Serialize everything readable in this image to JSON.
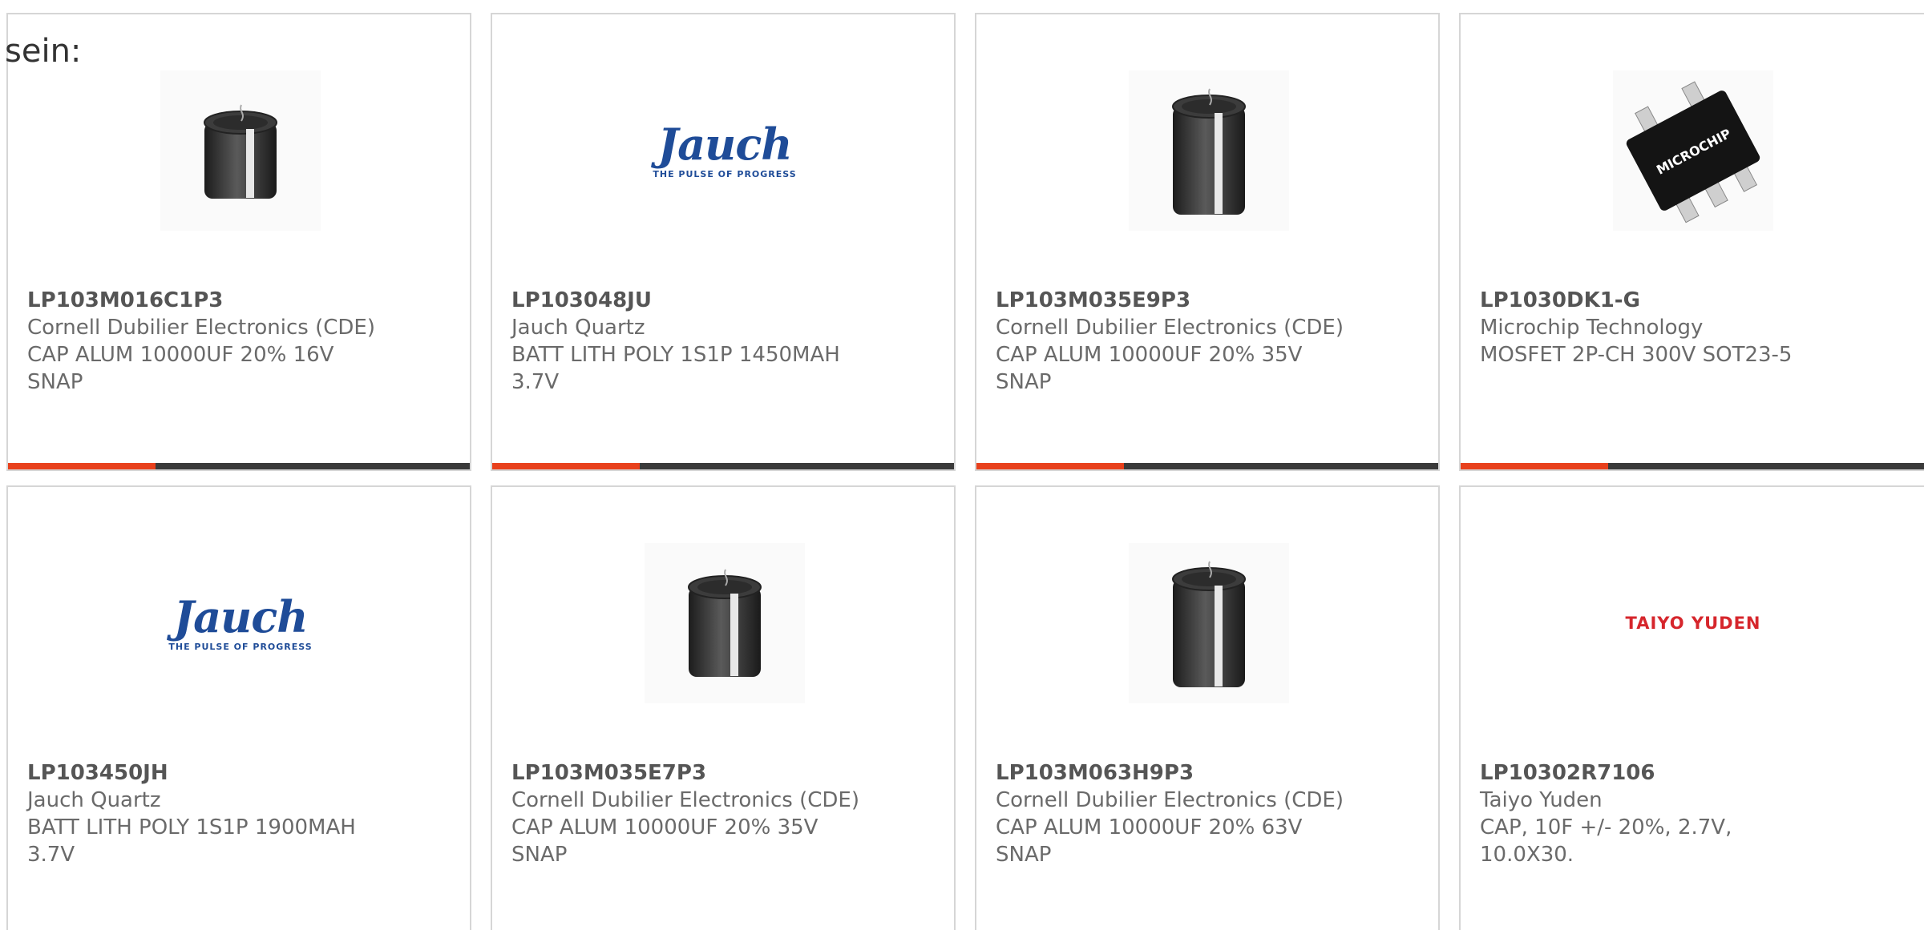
{
  "intro_text": "sein:",
  "colors": {
    "accent": "#e8401c",
    "bar": "#3a3a3a",
    "border": "#d6d6d6",
    "jauch_blue": "#1f4c98",
    "taiyo_red": "#d6262c"
  },
  "cards": [
    {
      "part_number": "LP103M016C1P3",
      "manufacturer": "Cornell Dubilier Electronics (CDE)",
      "description": "CAP ALUM 10000UF 20% 16V SNAP",
      "image": "capacitor-icon"
    },
    {
      "part_number": "LP103048JU",
      "manufacturer": "Jauch Quartz",
      "description": "BATT LITH POLY 1S1P 1450MAH 3.7V",
      "image": "jauch-logo",
      "logo_text": "Jauch",
      "logo_tagline": "THE PULSE OF PROGRESS"
    },
    {
      "part_number": "LP103M035E9P3",
      "manufacturer": "Cornell Dubilier Electronics (CDE)",
      "description": "CAP ALUM 10000UF 20% 35V SNAP",
      "image": "capacitor-icon"
    },
    {
      "part_number": "LP1030DK1-G",
      "manufacturer": "Microchip Technology",
      "description": "MOSFET 2P-CH 300V SOT23-5",
      "image": "sot23-chip-icon",
      "chip_text": "MICROCHIP"
    },
    {
      "part_number": "LP103450JH",
      "manufacturer": "Jauch Quartz",
      "description": "BATT LITH POLY 1S1P 1900MAH 3.7V",
      "image": "jauch-logo",
      "logo_text": "Jauch",
      "logo_tagline": "THE PULSE OF PROGRESS"
    },
    {
      "part_number": "LP103M035E7P3",
      "manufacturer": "Cornell Dubilier Electronics (CDE)",
      "description": "CAP ALUM 10000UF 20% 35V SNAP",
      "image": "capacitor-icon"
    },
    {
      "part_number": "LP103M063H9P3",
      "manufacturer": "Cornell Dubilier Electronics (CDE)",
      "description": "CAP ALUM 10000UF 20% 63V SNAP",
      "image": "capacitor-icon"
    },
    {
      "part_number": "LP10302R7106",
      "manufacturer": "Taiyo Yuden",
      "description": "CAP, 10F +/- 20%, 2.7V, 10.0X30.",
      "image": "taiyo-yuden-logo",
      "logo_text": "TAIYO YUDEN"
    }
  ]
}
